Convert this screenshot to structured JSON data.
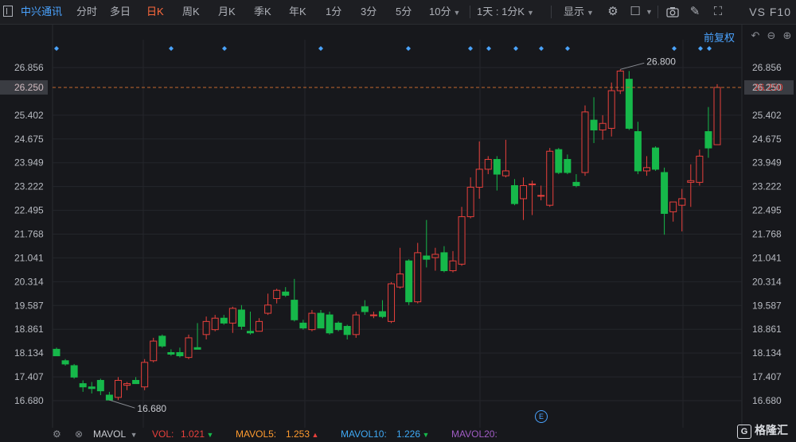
{
  "toolbar": {
    "stock_name": "中兴通讯",
    "tabs": [
      "分时",
      "多日",
      "日K",
      "周K",
      "月K",
      "季K",
      "年K",
      "1分",
      "3分",
      "5分",
      "10分"
    ],
    "active_tab": "日K",
    "period_select": "1天 : 1分K",
    "display_label": "显示",
    "vs_f10": "VS F10"
  },
  "adjust_label": "前复权",
  "price_axis": {
    "ticks": [
      "26.856",
      "26.250",
      "25.402",
      "24.675",
      "23.949",
      "23.222",
      "22.495",
      "21.768",
      "21.041",
      "20.314",
      "19.587",
      "18.861",
      "18.134",
      "17.407",
      "16.680"
    ],
    "current_price": "26.250"
  },
  "annotations": {
    "high": "26.800",
    "low": "16.680"
  },
  "earnings_marker": "E",
  "indicator": {
    "name": "MAVOL",
    "vol_label": "VOL:",
    "vol_value": "1.021",
    "mavol5_label": "MAVOL5:",
    "mavol5_value": "1.253",
    "mavol10_label": "MAVOL10:",
    "mavol10_value": "1.226",
    "mavol20_label": "MAVOL20:"
  },
  "watermark": "格隆汇",
  "colors": {
    "up": "#e8403c",
    "down": "#16b84a",
    "accent": "#ff6a3d",
    "link": "#4aa3ff"
  },
  "chart_data": {
    "type": "candlestick",
    "ylim": [
      16.68,
      26.856
    ],
    "event_markers_count": 13,
    "candles": [
      {
        "o": 18.25,
        "h": 18.3,
        "l": 18.05,
        "c": 18.05
      },
      {
        "o": 17.9,
        "h": 17.95,
        "l": 17.75,
        "c": 17.8
      },
      {
        "o": 17.75,
        "h": 17.8,
        "l": 17.35,
        "c": 17.4
      },
      {
        "o": 17.2,
        "h": 17.3,
        "l": 16.95,
        "c": 17.1
      },
      {
        "o": 17.1,
        "h": 17.25,
        "l": 16.9,
        "c": 17.05
      },
      {
        "o": 17.3,
        "h": 17.35,
        "l": 16.85,
        "c": 16.98
      },
      {
        "o": 16.85,
        "h": 16.95,
        "l": 16.7,
        "c": 16.7
      },
      {
        "o": 16.78,
        "h": 17.4,
        "l": 16.7,
        "c": 17.3
      },
      {
        "o": 17.15,
        "h": 17.25,
        "l": 17.0,
        "c": 17.2
      },
      {
        "o": 17.3,
        "h": 17.4,
        "l": 17.2,
        "c": 17.2
      },
      {
        "o": 17.1,
        "h": 17.95,
        "l": 17.0,
        "c": 17.85
      },
      {
        "o": 17.9,
        "h": 18.6,
        "l": 17.85,
        "c": 18.5
      },
      {
        "o": 18.65,
        "h": 18.7,
        "l": 18.3,
        "c": 18.35
      },
      {
        "o": 18.15,
        "h": 18.25,
        "l": 18.05,
        "c": 18.1
      },
      {
        "o": 18.15,
        "h": 18.3,
        "l": 18.0,
        "c": 18.05
      },
      {
        "o": 18.0,
        "h": 18.7,
        "l": 17.95,
        "c": 18.6
      },
      {
        "o": 18.3,
        "h": 19.05,
        "l": 18.25,
        "c": 18.25
      },
      {
        "o": 18.7,
        "h": 19.25,
        "l": 18.55,
        "c": 19.1
      },
      {
        "o": 18.85,
        "h": 19.3,
        "l": 18.8,
        "c": 19.2
      },
      {
        "o": 19.2,
        "h": 19.3,
        "l": 19.0,
        "c": 19.05
      },
      {
        "o": 19.05,
        "h": 19.55,
        "l": 18.75,
        "c": 19.5
      },
      {
        "o": 19.45,
        "h": 19.6,
        "l": 18.85,
        "c": 18.95
      },
      {
        "o": 18.8,
        "h": 19.4,
        "l": 18.7,
        "c": 18.75
      },
      {
        "o": 18.8,
        "h": 19.2,
        "l": 18.8,
        "c": 19.1
      },
      {
        "o": 19.35,
        "h": 19.95,
        "l": 19.3,
        "c": 19.6
      },
      {
        "o": 19.8,
        "h": 20.1,
        "l": 19.65,
        "c": 20.05
      },
      {
        "o": 20.0,
        "h": 20.15,
        "l": 19.85,
        "c": 19.9
      },
      {
        "o": 19.75,
        "h": 20.4,
        "l": 19.1,
        "c": 19.15
      },
      {
        "o": 19.05,
        "h": 19.15,
        "l": 18.85,
        "c": 18.9
      },
      {
        "o": 18.85,
        "h": 19.45,
        "l": 18.8,
        "c": 19.35
      },
      {
        "o": 19.35,
        "h": 19.45,
        "l": 18.9,
        "c": 18.9
      },
      {
        "o": 19.3,
        "h": 19.4,
        "l": 18.7,
        "c": 18.75
      },
      {
        "o": 19.05,
        "h": 19.1,
        "l": 18.8,
        "c": 18.85
      },
      {
        "o": 18.95,
        "h": 19.0,
        "l": 18.55,
        "c": 18.7
      },
      {
        "o": 18.7,
        "h": 19.4,
        "l": 18.6,
        "c": 19.3
      },
      {
        "o": 19.55,
        "h": 19.75,
        "l": 19.3,
        "c": 19.4
      },
      {
        "o": 19.3,
        "h": 19.4,
        "l": 19.2,
        "c": 19.3
      },
      {
        "o": 19.4,
        "h": 19.75,
        "l": 19.2,
        "c": 19.25
      },
      {
        "o": 19.1,
        "h": 20.3,
        "l": 19.05,
        "c": 20.25
      },
      {
        "o": 20.15,
        "h": 21.35,
        "l": 20.1,
        "c": 20.55
      },
      {
        "o": 20.95,
        "h": 21.0,
        "l": 19.6,
        "c": 19.7
      },
      {
        "o": 19.7,
        "h": 21.5,
        "l": 19.65,
        "c": 21.2
      },
      {
        "o": 21.1,
        "h": 22.2,
        "l": 20.75,
        "c": 21.0
      },
      {
        "o": 21.05,
        "h": 21.35,
        "l": 20.65,
        "c": 21.15
      },
      {
        "o": 21.2,
        "h": 21.4,
        "l": 20.6,
        "c": 20.65
      },
      {
        "o": 20.65,
        "h": 21.25,
        "l": 20.6,
        "c": 20.95
      },
      {
        "o": 20.85,
        "h": 22.6,
        "l": 20.8,
        "c": 22.3
      },
      {
        "o": 22.3,
        "h": 23.5,
        "l": 22.25,
        "c": 23.2
      },
      {
        "o": 23.2,
        "h": 24.6,
        "l": 22.85,
        "c": 23.75
      },
      {
        "o": 23.75,
        "h": 24.15,
        "l": 23.6,
        "c": 24.05
      },
      {
        "o": 24.05,
        "h": 24.15,
        "l": 23.1,
        "c": 23.6
      },
      {
        "o": 23.55,
        "h": 24.65,
        "l": 23.5,
        "c": 23.7
      },
      {
        "o": 23.25,
        "h": 23.45,
        "l": 22.65,
        "c": 22.7
      },
      {
        "o": 22.85,
        "h": 23.5,
        "l": 22.2,
        "c": 23.25
      },
      {
        "o": 23.3,
        "h": 23.4,
        "l": 22.35,
        "c": 23.3
      },
      {
        "o": 22.95,
        "h": 23.25,
        "l": 22.8,
        "c": 22.95
      },
      {
        "o": 22.65,
        "h": 24.4,
        "l": 22.6,
        "c": 24.3
      },
      {
        "o": 24.35,
        "h": 24.4,
        "l": 23.6,
        "c": 23.65
      },
      {
        "o": 24.05,
        "h": 24.2,
        "l": 23.6,
        "c": 23.65
      },
      {
        "o": 23.35,
        "h": 23.6,
        "l": 23.2,
        "c": 23.25
      },
      {
        "o": 23.65,
        "h": 25.7,
        "l": 23.55,
        "c": 25.5
      },
      {
        "o": 25.25,
        "h": 25.95,
        "l": 24.55,
        "c": 24.95
      },
      {
        "o": 24.95,
        "h": 25.4,
        "l": 24.65,
        "c": 25.15
      },
      {
        "o": 25.0,
        "h": 26.4,
        "l": 24.75,
        "c": 26.15
      },
      {
        "o": 26.15,
        "h": 26.8,
        "l": 26.05,
        "c": 26.75
      },
      {
        "o": 26.5,
        "h": 26.75,
        "l": 24.95,
        "c": 25.0
      },
      {
        "o": 24.9,
        "h": 25.2,
        "l": 23.6,
        "c": 23.7
      },
      {
        "o": 23.7,
        "h": 24.15,
        "l": 23.55,
        "c": 23.8
      },
      {
        "o": 24.4,
        "h": 24.45,
        "l": 23.7,
        "c": 23.75
      },
      {
        "o": 23.65,
        "h": 23.8,
        "l": 21.75,
        "c": 22.4
      },
      {
        "o": 22.45,
        "h": 22.75,
        "l": 22.15,
        "c": 22.75
      },
      {
        "o": 22.65,
        "h": 23.15,
        "l": 21.85,
        "c": 22.85
      },
      {
        "o": 23.35,
        "h": 23.9,
        "l": 22.6,
        "c": 23.4
      },
      {
        "o": 23.35,
        "h": 24.35,
        "l": 23.25,
        "c": 24.15
      },
      {
        "o": 24.9,
        "h": 25.65,
        "l": 24.1,
        "c": 24.4
      },
      {
        "o": 24.5,
        "h": 26.35,
        "l": 24.5,
        "c": 26.25
      }
    ]
  }
}
